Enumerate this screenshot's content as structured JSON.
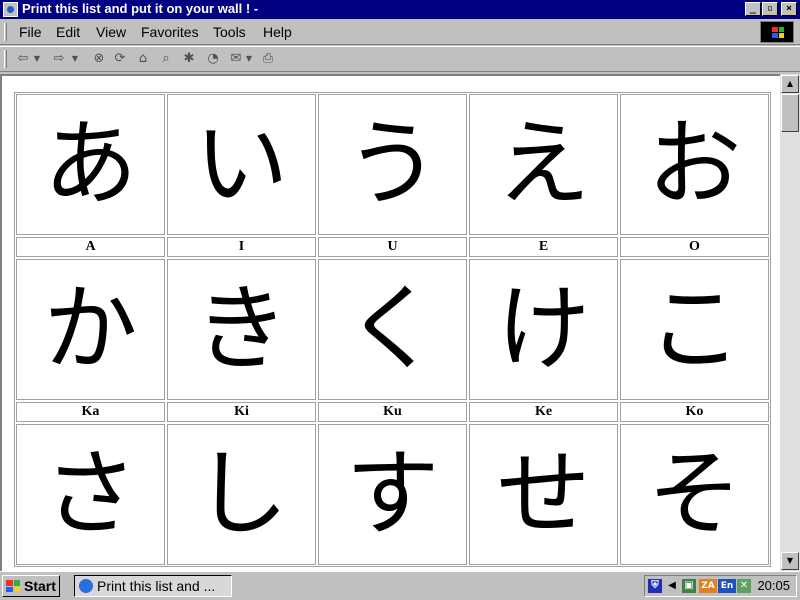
{
  "window": {
    "title": "Print this list and put it on your wall ! -",
    "min_glyph": "_",
    "max_glyph": "▫",
    "close_glyph": "×"
  },
  "menu": {
    "items": [
      "File",
      "Edit",
      "View",
      "Favorites",
      "Tools",
      "Help"
    ]
  },
  "toolbar": {
    "icons": [
      "back-icon",
      "forward-icon",
      "stop-icon",
      "refresh-icon",
      "home-icon",
      "search-icon",
      "favorites-icon",
      "history-icon",
      "mail-icon",
      "print-icon"
    ]
  },
  "kana_table": {
    "rows": [
      {
        "kana": [
          "あ",
          "い",
          "う",
          "え",
          "お"
        ],
        "romaji": [
          "A",
          "I",
          "U",
          "E",
          "O"
        ]
      },
      {
        "kana": [
          "か",
          "き",
          "く",
          "け",
          "こ"
        ],
        "romaji": [
          "Ka",
          "Ki",
          "Ku",
          "Ke",
          "Ko"
        ]
      },
      {
        "kana": [
          "さ",
          "し",
          "す",
          "せ",
          "そ"
        ],
        "romaji": []
      }
    ]
  },
  "taskbar": {
    "start_label": "Start",
    "task_label": "Print this list and ...",
    "clock": "20:05",
    "tray_za": "ZA",
    "tray_en": "En"
  },
  "colors": {
    "titlebar": "#000080",
    "chrome": "#c0c0c0",
    "content_bg": "#ffffff"
  }
}
